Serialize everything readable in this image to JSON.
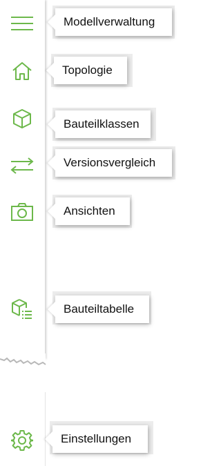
{
  "accent_color": "#6cb84a",
  "menu": {
    "hamburger_icon": "menu-icon",
    "items": [
      {
        "icon": "home-icon",
        "label": "Modellverwaltung"
      },
      {
        "icon": "home-icon",
        "label": "Topologie"
      },
      {
        "icon": "cube-icon",
        "label": "Bauteilklassen"
      },
      {
        "icon": "swap-arrows-icon",
        "label": "Versionsvergleich"
      },
      {
        "icon": "camera-icon",
        "label": "Ansichten"
      },
      {
        "icon": "cube-table-icon",
        "label": "Bauteiltabelle"
      },
      {
        "icon": "gear-icon",
        "label": "Einstellungen"
      }
    ]
  }
}
